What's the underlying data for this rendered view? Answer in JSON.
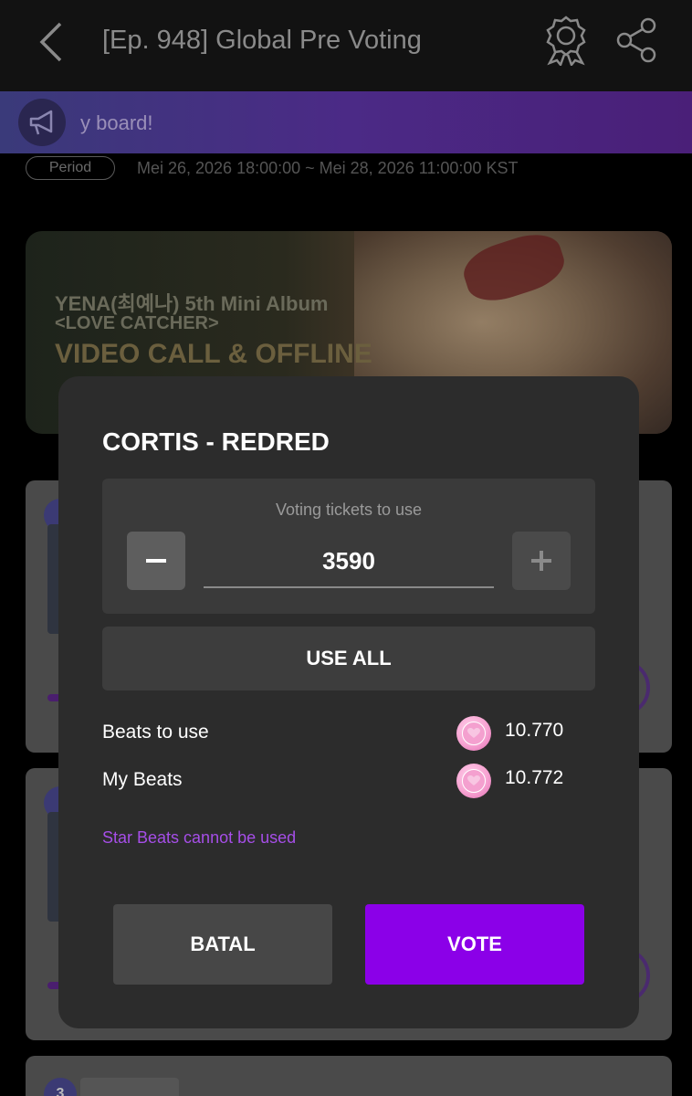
{
  "header": {
    "title": "[Ep. 948] Global Pre Voting",
    "back_icon": "chevron-left-icon",
    "award_icon": "award-icon",
    "share_icon": "share-icon"
  },
  "notice": {
    "icon": "megaphone-icon",
    "text": "y board!"
  },
  "period": {
    "badge": "Period",
    "range": "Mei 26, 2026 18:00:00 ~ Mei 28, 2026 11:00:00 KST"
  },
  "banner": {
    "line1": "YENA(최예나) 5th Mini Album",
    "line2": "<LOVE CATCHER>",
    "line3": "VIDEO CALL & OFFLINE"
  },
  "cards": [
    {
      "rank": ""
    },
    {
      "rank": ""
    },
    {
      "rank": "3"
    }
  ],
  "modal": {
    "title": "CORTIS - REDRED",
    "tickets_label": "Voting tickets to use",
    "tickets_value": "3590",
    "minus_label": "−",
    "plus_label": "+",
    "use_all_label": "USE ALL",
    "beats_to_use_label": "Beats to use",
    "beats_to_use_value": "10.770",
    "my_beats_label": "My Beats",
    "my_beats_value": "10.772",
    "beat_icon": "heart-coin-icon",
    "warning": "Star Beats cannot be used",
    "cancel_label": "BATAL",
    "vote_label": "VOTE"
  },
  "colors": {
    "accent": "#8b00e8",
    "warning": "#a64ee8",
    "modal_bg": "#2c2c2c"
  }
}
